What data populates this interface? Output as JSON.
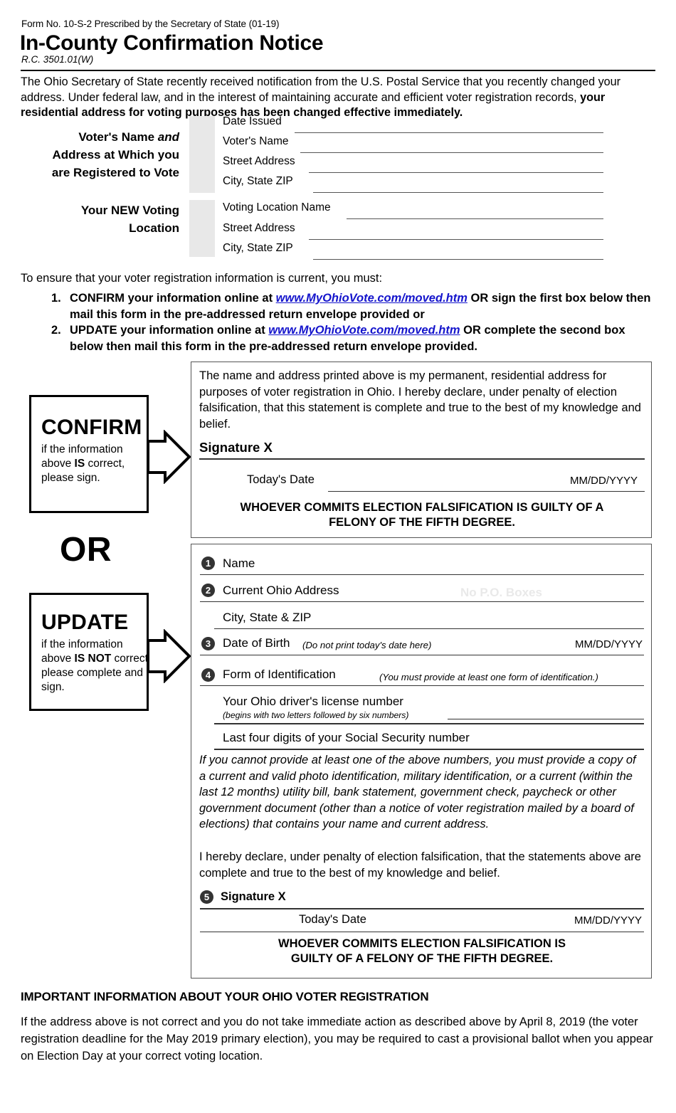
{
  "header": {
    "form_no": "Form No. 10-S-2 Prescribed by the Secretary of State (01-19)",
    "title": "In-County Confirmation Notice",
    "rc": "R.C. 3501.01(W)",
    "intro_part1": "The Ohio Secretary of State recently received notification from the U.S. Postal Service that you recently changed your address. Under federal law, and in the interest of maintaining accurate and efficient voter registration records, ",
    "intro_bold": "your residential address for voting purposes has been changed effective immediately."
  },
  "registered_block": {
    "label_line1": "Voter's Name ",
    "label_line1_italic": "and",
    "label_line2": "Address at Which you",
    "label_line3": "are Registered to Vote",
    "fields": [
      "Date Issued",
      "Voter's Name",
      "Street Address",
      "City, State  ZIP"
    ]
  },
  "new_location_block": {
    "label_line1": "Your NEW Voting",
    "label_line2": "Location",
    "fields": [
      "Voting Location Name",
      "Street Address",
      "City, State  ZIP"
    ]
  },
  "instructions": {
    "lead": "To ensure that your voter registration information is current, you must:",
    "items": [
      {
        "num": "1.",
        "before": "CONFIRM your information online at ",
        "url": "www.MyOhioVote.com/moved.htm",
        "after": " OR sign the first box below then mail this form in the pre-addressed return envelope provided or"
      },
      {
        "num": "2.",
        "before": "UPDATE your information online at ",
        "url": "www.MyOhioVote.com/moved.htm",
        "after": " OR complete the second box below then mail this form in the pre-addressed return envelope provided."
      }
    ]
  },
  "confirm_side": {
    "word": "CONFIRM",
    "sub_before": "if the information above ",
    "sub_bold": "IS",
    "sub_after": " correct, please sign."
  },
  "or_word": "OR",
  "update_side": {
    "word": "UPDATE",
    "sub_before": "if the information above ",
    "sub_bold": "IS NOT",
    "sub_after": " correct, please complete and sign."
  },
  "confirm_panel": {
    "declaration": "The name and address printed above is my permanent, residential address for purposes of voter registration in Ohio. I hereby declare, under penalty of election falsification, that this statement is complete and true to the best of my knowledge and belief.",
    "signature_label": "Signature X",
    "todays_date_label": "Today's Date",
    "date_format": "MM/DD/YYYY",
    "felony_line1": "WHOEVER COMMITS ELECTION FALSIFICATION IS GUILTY OF A",
    "felony_line2": "FELONY OF THE FIFTH DEGREE."
  },
  "update_panel": {
    "items": [
      {
        "num": "1",
        "label": "Name"
      },
      {
        "num": "2",
        "label": "Current Ohio Address",
        "watermark": "No P.O. Boxes"
      },
      {
        "num": "",
        "label": "City, State & ZIP"
      },
      {
        "num": "3",
        "label": "Date of Birth",
        "note": "(Do not print today's date here)",
        "right": "MM/DD/YYYY"
      },
      {
        "num": "4",
        "label": "Form of Identification",
        "note": "(You must provide at least one form of identification.)"
      }
    ],
    "id_line1": "Your Ohio driver's license number",
    "id_line1_note": "(begins with two letters followed by six numbers)",
    "id_line2": "Last four digits of your Social Security number",
    "alt_id_paragraph": "If you cannot provide at least one of the above numbers, you must provide a copy of a current and valid photo identification, military identification, or a current (within the last 12 months) utility bill, bank statement, government check, paycheck or other government document (other than a notice of voter registration mailed by a board of elections) that contains your name and current address.",
    "declaration": "I hereby declare, under penalty of election falsification, that the statements above are complete and true to the best of my knowledge and belief.",
    "signature_num": "5",
    "signature_label": "Signature X",
    "todays_date_label": "Today's Date",
    "date_format": "MM/DD/YYYY",
    "felony_line1": "WHOEVER COMMITS ELECTION FALSIFICATION IS",
    "felony_line2": "GUILTY OF A FELONY OF THE FIFTH DEGREE."
  },
  "footer": {
    "heading": "IMPORTANT INFORMATION ABOUT YOUR OHIO VOTER REGISTRATION",
    "body": "If the address above is not correct and you do not take immediate action as described above by April 8, 2019 (the voter registration deadline for the May 2019 primary election), you may be required to cast a provisional ballot when you appear on Election Day at your correct voting location."
  }
}
